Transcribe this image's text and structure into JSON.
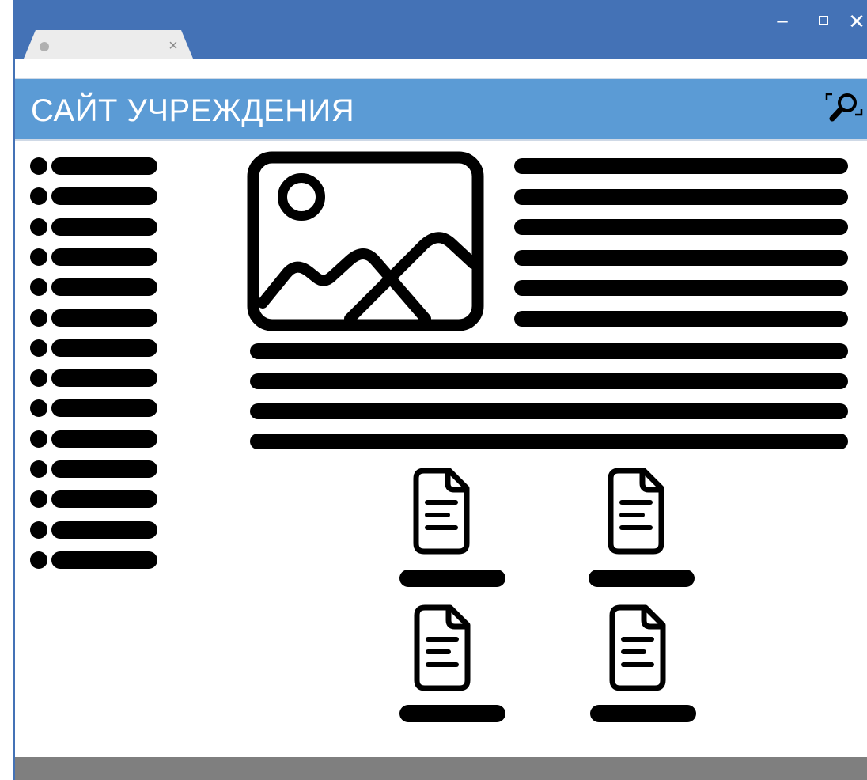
{
  "browser": {
    "tab": {
      "close_glyph": "×"
    },
    "controls": {
      "minimize_glyph": "–",
      "close_glyph": "✕"
    }
  },
  "site": {
    "title": "САЙТ УЧРЕЖДЕНИЯ",
    "search_icon": "search-icon",
    "colors": {
      "frame": "#4472b6",
      "header": "#5b9bd5",
      "footer": "#7f7f7f"
    }
  },
  "sidebar": {
    "item_count": 14,
    "icon": "bullet-icon"
  },
  "article": {
    "image_icon": "image-icon",
    "side_line_count": 6,
    "body_line_count": 4
  },
  "documents": {
    "count": 4,
    "icon": "document-icon"
  }
}
